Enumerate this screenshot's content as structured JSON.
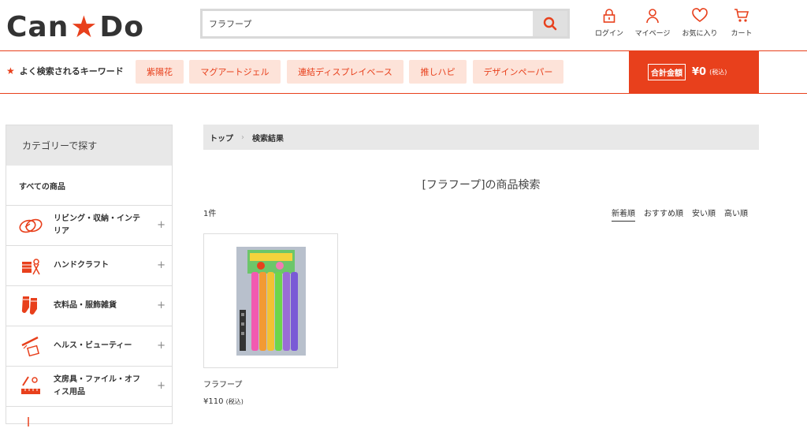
{
  "header": {
    "logo_left": "Can",
    "logo_right": "Do",
    "search_value": "フラフープ",
    "icons": [
      {
        "label": "ログイン",
        "icon": "lock-icon"
      },
      {
        "label": "マイページ",
        "icon": "user-icon"
      },
      {
        "label": "お気に入り",
        "icon": "heart-icon"
      },
      {
        "label": "カート",
        "icon": "cart-icon"
      }
    ]
  },
  "keywords": {
    "title": "よく検索されるキーワード",
    "items": [
      "紫陽花",
      "マグアートジェル",
      "連結ディスプレイベース",
      "推しハピ",
      "デザインペーパー"
    ]
  },
  "cart_total": {
    "label": "合計金額",
    "amount": "¥0",
    "tax": "(税込)"
  },
  "sidebar": {
    "title": "カテゴリーで探す",
    "all": "すべての商品",
    "items": [
      {
        "label": "リビング・収納・インテリア",
        "icon": "living-icon"
      },
      {
        "label": "ハンドクラフト",
        "icon": "craft-icon"
      },
      {
        "label": "衣料品・服飾雑貨",
        "icon": "clothing-icon"
      },
      {
        "label": "ヘルス・ビューティー",
        "icon": "beauty-icon"
      },
      {
        "label": "文房具・ファイル・オフィス用品",
        "icon": "stationery-icon"
      }
    ]
  },
  "breadcrumb": {
    "home": "トップ",
    "current": "検索結果"
  },
  "main": {
    "title": "[フラフープ]の商品検索",
    "count": "1件",
    "sorts": [
      "新着順",
      "おすすめ順",
      "安い順",
      "高い順"
    ],
    "active_sort": "新着順"
  },
  "product": {
    "name": "フラフープ",
    "price": "¥110",
    "tax": "(税込)"
  },
  "colors": {
    "accent": "#e8401c",
    "chip_bg": "#fde3d9"
  }
}
